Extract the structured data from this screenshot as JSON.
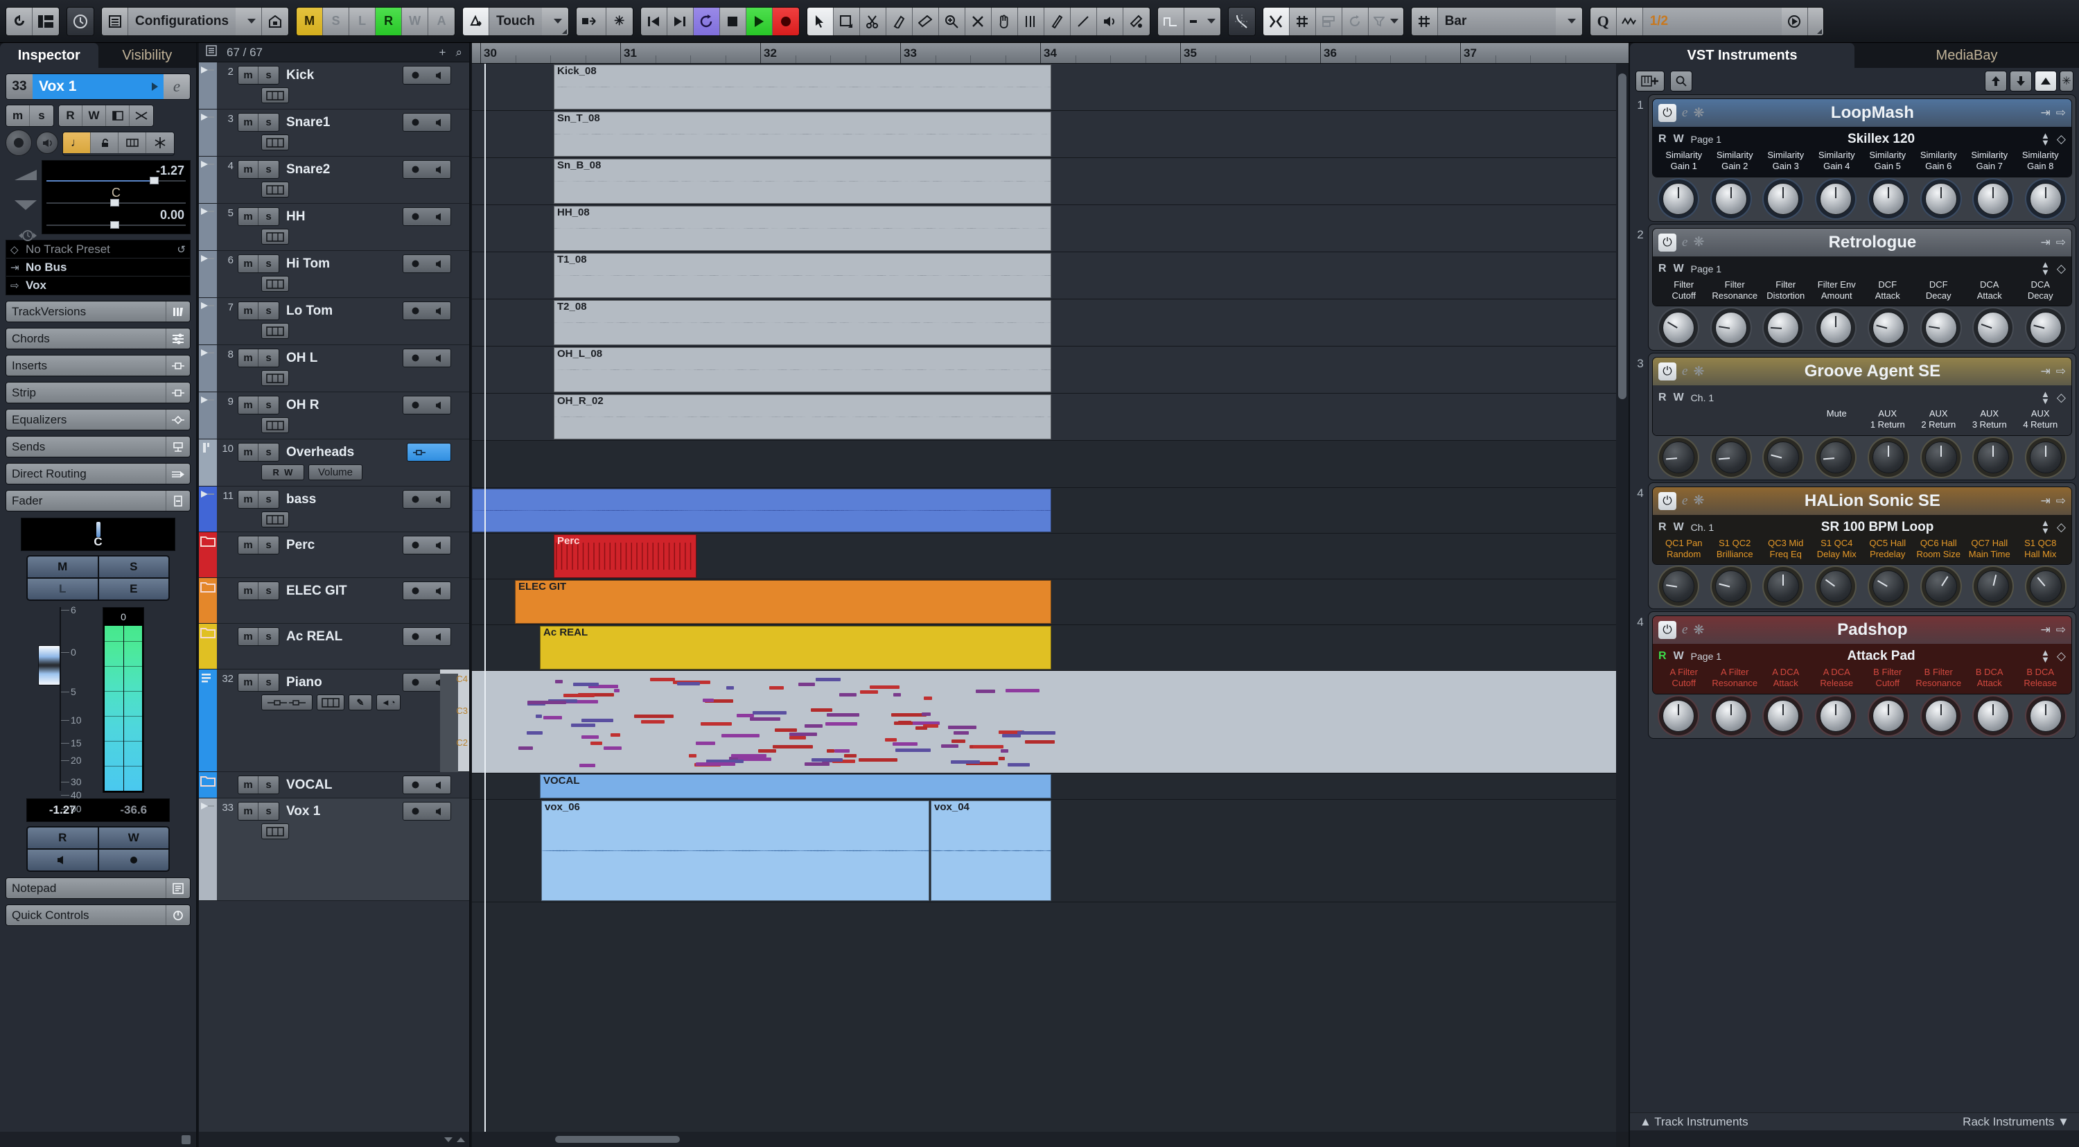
{
  "toolbar": {
    "config_label": "Configurations",
    "automation_modes": [
      "M",
      "S",
      "L",
      "R",
      "W",
      "A"
    ],
    "automation_active": [
      "M",
      "R"
    ],
    "touch_label": "Touch",
    "transport": [
      "go-to-start",
      "go-to-end",
      "cycle",
      "stop",
      "play",
      "record"
    ],
    "snap_type_label": "Bar",
    "quantize_value": "1/2",
    "tools": [
      "arrow",
      "range",
      "scissors",
      "glue",
      "erase",
      "zoom",
      "mute",
      "hand",
      "comp",
      "draw",
      "line",
      "play-tool",
      "color"
    ]
  },
  "inspector": {
    "tabs": [
      {
        "label": "Inspector",
        "active": true
      },
      {
        "label": "Visibility",
        "active": false
      }
    ],
    "track_number": "33",
    "track_name": "Vox 1",
    "buttons": {
      "mute": "m",
      "solo": "s",
      "read": "R",
      "write": "W"
    },
    "volume_value": "-1.27",
    "pan_value": "C",
    "delay_value": "0.00",
    "routing": [
      {
        "label": "No Track Preset",
        "dim": true
      },
      {
        "label": "No Bus",
        "dim": false
      },
      {
        "label": "Vox",
        "dim": false
      }
    ],
    "sections": [
      {
        "label": "TrackVersions",
        "icon": "versions-icon"
      },
      {
        "label": "Chords",
        "icon": "chords-icon"
      },
      {
        "label": "Inserts",
        "icon": "inserts-icon"
      },
      {
        "label": "Strip",
        "icon": "strip-icon"
      },
      {
        "label": "Equalizers",
        "icon": "eq-icon"
      },
      {
        "label": "Sends",
        "icon": "sends-icon"
      },
      {
        "label": "Direct Routing",
        "icon": "routing-icon"
      },
      {
        "label": "Fader",
        "icon": "fader-icon"
      }
    ],
    "fader_pan": "C",
    "msle": [
      "M",
      "S",
      "L",
      "E"
    ],
    "scale_ticks": [
      "6",
      "0",
      "5",
      "10",
      "15",
      "20",
      "30",
      "40",
      "00"
    ],
    "meter_top": "0",
    "db_left": "-1.27",
    "db_right": "-36.6",
    "rw_buttons": [
      "R",
      "W"
    ],
    "notepad_label": "Notepad",
    "quick_controls_label": "Quick Controls"
  },
  "tracklist": {
    "count": "67 / 67",
    "tracks": [
      {
        "num": "2",
        "name": "Kick",
        "color": "#7e8b9c",
        "type": "audio",
        "h": 68,
        "badge": "lane-icon"
      },
      {
        "num": "3",
        "name": "Snare1",
        "color": "#7e8b9c",
        "type": "audio",
        "h": 68,
        "badge": "lane-icon"
      },
      {
        "num": "4",
        "name": "Snare2",
        "color": "#7e8b9c",
        "type": "audio",
        "h": 68,
        "badge": "lane-icon"
      },
      {
        "num": "5",
        "name": "HH",
        "color": "#7e8b9c",
        "type": "audio",
        "h": 68,
        "badge": "lane-icon"
      },
      {
        "num": "6",
        "name": "Hi Tom",
        "color": "#7e8b9c",
        "type": "audio",
        "h": 68,
        "badge": "lane-icon"
      },
      {
        "num": "7",
        "name": "Lo Tom",
        "color": "#7e8b9c",
        "type": "audio",
        "h": 68,
        "badge": "lane-icon"
      },
      {
        "num": "8",
        "name": "OH L",
        "color": "#7e8b9c",
        "type": "audio",
        "h": 68,
        "badge": "lane-icon"
      },
      {
        "num": "9",
        "name": "OH R",
        "color": "#7e8b9c",
        "type": "audio",
        "h": 68,
        "badge": "lane-icon"
      },
      {
        "num": "10",
        "name": "Overheads",
        "color": "#9aa7b6",
        "type": "automation",
        "h": 68,
        "auto_r": "R",
        "auto_w": "W",
        "auto_param": "Volume"
      },
      {
        "num": "11",
        "name": "bass",
        "color": "#4166d6",
        "type": "audio",
        "h": 66,
        "badge": "lane-icon"
      },
      {
        "num": "",
        "name": "Perc",
        "color": "#d0232a",
        "type": "folder",
        "h": 66
      },
      {
        "num": "",
        "name": "ELEC GIT",
        "color": "#e4872a",
        "type": "folder",
        "h": 66
      },
      {
        "num": "",
        "name": "Ac REAL",
        "color": "#e0c023",
        "type": "folder",
        "h": 66
      },
      {
        "num": "32",
        "name": "Piano",
        "color": "#2a93ea",
        "type": "midi",
        "h": 148
      },
      {
        "num": "",
        "name": "VOCAL",
        "color": "#2a93ea",
        "type": "folder",
        "h": 38
      },
      {
        "num": "33",
        "name": "Vox 1",
        "color": "#aeb6c0",
        "type": "audio",
        "h": 148,
        "selected": true,
        "badge": "lane-icon"
      }
    ]
  },
  "arrange": {
    "bars": [
      "30",
      "31",
      "32",
      "33",
      "34",
      "35",
      "36",
      "37"
    ],
    "clips": [
      {
        "track": 0,
        "label": "Kick_08",
        "style": "wave-gray"
      },
      {
        "track": 1,
        "label": "Sn_T_08",
        "style": "wave-gray"
      },
      {
        "track": 2,
        "label": "Sn_B_08",
        "style": "wave-gray"
      },
      {
        "track": 3,
        "label": "HH_08",
        "style": "wave-gray"
      },
      {
        "track": 4,
        "label": "T1_08",
        "style": "wave-gray"
      },
      {
        "track": 5,
        "label": "T2_08",
        "style": "wave-gray"
      },
      {
        "track": 6,
        "label": "OH_L_08",
        "style": "wave-gray"
      },
      {
        "track": 7,
        "label": "OH_R_02",
        "style": "wave-gray"
      },
      {
        "track": 9,
        "label": "",
        "style": "wave-blue"
      },
      {
        "track": 10,
        "label": "Perc",
        "style": "clip-red"
      },
      {
        "track": 11,
        "label": "ELEC GIT",
        "style": "clip-orange"
      },
      {
        "track": 12,
        "label": "Ac REAL",
        "style": "clip-yellow"
      },
      {
        "track": 14,
        "label": "VOCAL",
        "style": "clip-blue"
      },
      {
        "track": 15,
        "label": "vox_06",
        "style": "clip-lblue"
      },
      {
        "track": 15,
        "label": "vox_04",
        "style": "clip-lblue"
      }
    ]
  },
  "rightzone": {
    "tabs": [
      {
        "label": "VST Instruments",
        "active": true
      },
      {
        "label": "MediaBay",
        "active": false
      }
    ],
    "footer_left": "Track Instruments",
    "footer_right": "Rack Instruments",
    "instruments": [
      {
        "slot": "1",
        "name": "LoopMash",
        "read": "R",
        "write": "W",
        "page": "Page 1",
        "preset": "Skillex 120",
        "accent": "#5b8ec9",
        "knob_style": "light-blue",
        "params": [
          "Similarity\nGain 1",
          "Similarity\nGain 2",
          "Similarity\nGain 3",
          "Similarity\nGain 4",
          "Similarity\nGain 5",
          "Similarity\nGain 6",
          "Similarity\nGain 7",
          "Similarity\nGain 8"
        ],
        "values": [
          50,
          50,
          50,
          50,
          50,
          50,
          50,
          50
        ],
        "label_color": "#e8eef5",
        "panel_bg": "#0d1016"
      },
      {
        "slot": "2",
        "name": "Retrologue",
        "read": "R",
        "write": "W",
        "page": "Page 1",
        "preset": "",
        "accent": "#8a8f96",
        "knob_style": "light-gray",
        "params": [
          "Filter\nCutoff",
          "Filter\nResonance",
          "Filter\nDistortion",
          "Filter Env\nAmount",
          "DCF\nAttack",
          "DCF\nDecay",
          "DCA\nAttack",
          "DCA\nDecay"
        ],
        "values": [
          28,
          20,
          18,
          50,
          22,
          20,
          24,
          22
        ],
        "label_color": "#e2e7ec",
        "panel_bg": "#17191d"
      },
      {
        "slot": "3",
        "name": "Groove Agent SE",
        "read": "R",
        "write": "W",
        "page": "Ch. 1",
        "preset": "",
        "accent": "#c0a54d",
        "knob_style": "dark-amber",
        "params": [
          "",
          "",
          "",
          "Mute",
          "AUX\n1 Return",
          "AUX\n2 Return",
          "AUX\n3 Return",
          "AUX\n4 Return"
        ],
        "values": [
          15,
          15,
          22,
          15,
          50,
          50,
          50,
          50
        ],
        "label_color": "#e8eef5",
        "panel_bg": "#2c3038"
      },
      {
        "slot": "4",
        "name": "HALion Sonic SE",
        "read": "R",
        "write": "W",
        "page": "Ch. 1",
        "preset": "SR 100 BPM Loop",
        "accent": "#b87b26",
        "knob_style": "dark-amber",
        "params": [
          "QC1 Pan\nRandom",
          "S1 QC2\nBrilliance",
          "QC3 Mid\nFreq Eq",
          "S1 QC4\nDelay Mix",
          "QC5 Hall\nPredelay",
          "QC6 Hall\nRoom Size",
          "QC7 Hall\nMain Time",
          "S1 QC8\nHall Mix"
        ],
        "values": [
          20,
          22,
          50,
          30,
          28,
          62,
          55,
          35
        ],
        "label_color": "#e79a28",
        "panel_bg": "#1d1c1a"
      },
      {
        "slot": "4",
        "name": "Padshop",
        "read": "R",
        "write": "W",
        "read_on": true,
        "page": "Page 1",
        "preset": "Attack Pad",
        "accent": "#8f2e2e",
        "knob_style": "light-red",
        "params": [
          "A Filter\nCutoff",
          "A Filter\nResonance",
          "A DCA\nAttack",
          "A DCA\nRelease",
          "B Filter\nCutoff",
          "B Filter\nResonance",
          "B DCA\nAttack",
          "B DCA\nRelease"
        ],
        "values": [
          50,
          50,
          50,
          50,
          50,
          50,
          50,
          50
        ],
        "label_color": "#d4493f",
        "panel_bg": "#3a1614"
      }
    ]
  }
}
